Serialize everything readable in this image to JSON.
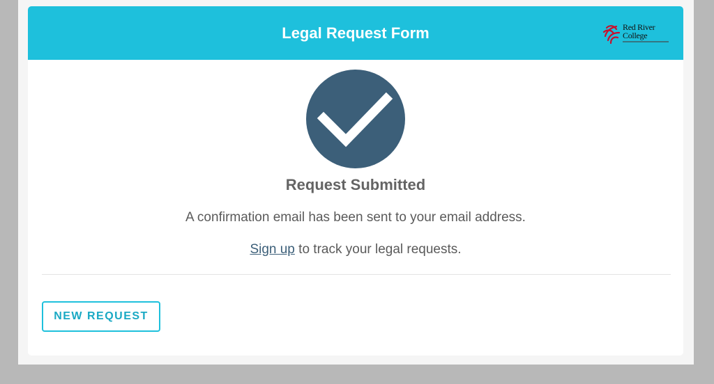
{
  "header": {
    "title": "Legal Request Form",
    "logo": {
      "line1": "Red River",
      "line2": "College",
      "icon": "maple-leaf-logo-icon",
      "accent_color": "#c8102e"
    },
    "background_color": "#1ec0dc"
  },
  "confirmation": {
    "icon": "check-icon",
    "icon_circle_color": "#3c5f79",
    "title": "Request Submitted",
    "message": "A confirmation email has been sent to your email address.",
    "signup_link_text": "Sign up",
    "signup_suffix": " to track your legal requests."
  },
  "actions": {
    "new_request_label": "NEW REQUEST",
    "accent_color": "#1ec0dc"
  }
}
